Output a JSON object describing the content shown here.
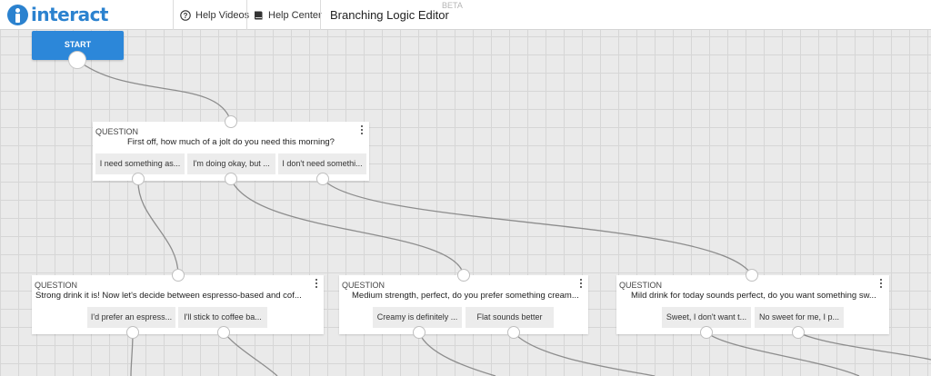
{
  "header": {
    "logo_text": "interact",
    "help_videos": "Help Videos",
    "help_center": "Help Center",
    "editor_title": "Branching Logic Editor",
    "beta": "BETA"
  },
  "start": {
    "label": "START"
  },
  "nodes": {
    "q1": {
      "type": "QUESTION",
      "text": "First off, how much of a jolt do you need this morning?",
      "answers": [
        "I need something as...",
        "I'm doing okay, but ...",
        "I don't need somethi..."
      ]
    },
    "q2": {
      "type": "QUESTION",
      "text": "Strong drink it is! Now let's decide between espresso-based and cof...",
      "answers": [
        "I'd prefer an espress...",
        "I'll stick to coffee ba..."
      ]
    },
    "q3": {
      "type": "QUESTION",
      "text": "Medium strength, perfect, do you prefer something cream...",
      "answers": [
        "Creamy is definitely ...",
        "Flat sounds better"
      ]
    },
    "q4": {
      "type": "QUESTION",
      "text": "Mild drink for today sounds perfect, do you want something sw...",
      "answers": [
        "Sweet, I don't want t...",
        "No sweet for me, I p..."
      ]
    }
  },
  "colors": {
    "brand": "#2b82cf",
    "start_button": "#2c87d9",
    "canvas": "#eaeaea",
    "connector": "#8d8d8d"
  },
  "icons": {
    "help_videos": "question-circle-icon",
    "help_center": "book-icon",
    "node_menu": "kebab-menu-icon"
  }
}
